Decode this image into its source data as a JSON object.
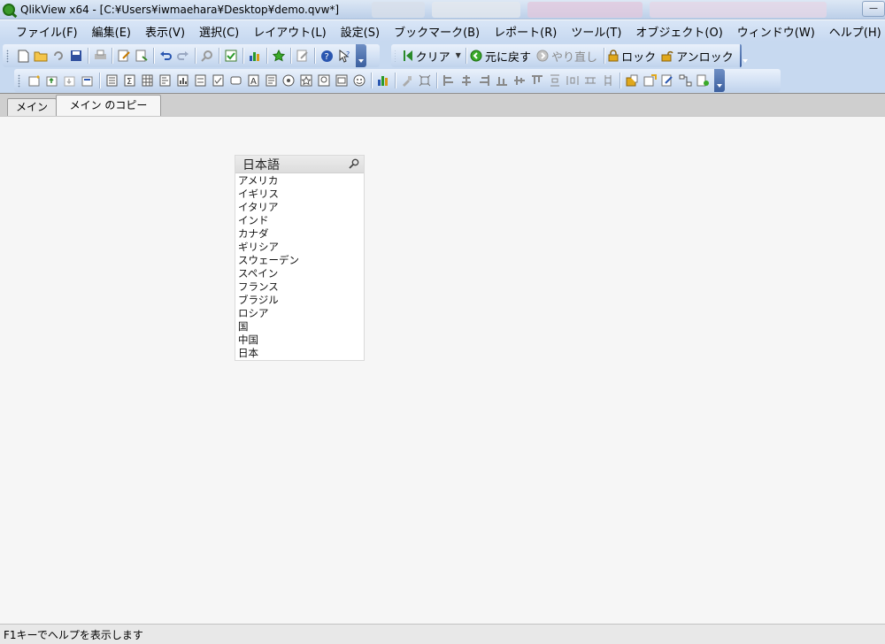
{
  "window": {
    "title": "QlikView x64 - [C:¥Users¥iwmaehara¥Desktop¥demo.qvw*]"
  },
  "menu": {
    "items": [
      "ファイル(F)",
      "編集(E)",
      "表示(V)",
      "選択(C)",
      "レイアウト(L)",
      "設定(S)",
      "ブックマーク(B)",
      "レポート(R)",
      "ツール(T)",
      "オブジェクト(O)",
      "ウィンドウ(W)",
      "ヘルプ(H)"
    ]
  },
  "toolbar_nav": {
    "clear_label": "クリア",
    "back_label": "元に戻す",
    "forward_label": "やり直し",
    "lock_label": "ロック",
    "unlock_label": "アンロック"
  },
  "tabs": [
    {
      "label": "メイン",
      "active": false
    },
    {
      "label": "メイン のコピー",
      "active": true
    }
  ],
  "listbox": {
    "title": "日本語",
    "items": [
      "アメリカ",
      "イギリス",
      "イタリア",
      "インド",
      "カナダ",
      "ギリシア",
      "スウェーデン",
      "スペイン",
      "フランス",
      "ブラジル",
      "ロシア",
      "国",
      "中国",
      "日本"
    ]
  },
  "status": {
    "text": "F1キーでヘルプを表示します"
  },
  "colors": {
    "chrome_blue": "#c7d9f0",
    "sheet_background": "#f6f6f6",
    "app_icon_green": "#3a9a2a"
  }
}
